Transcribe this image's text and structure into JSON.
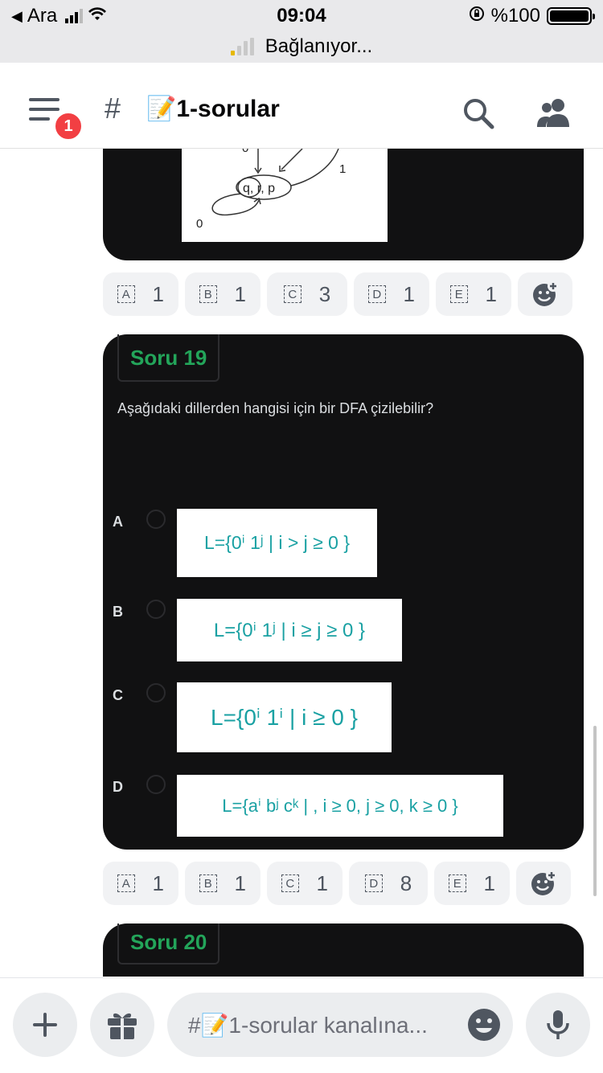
{
  "status_bar": {
    "back_label": "Ara",
    "time": "09:04",
    "battery_text": "%100",
    "connecting_text": "Bağlanıyor..."
  },
  "header": {
    "notification_count": "1",
    "channel_hash": "#",
    "channel_emoji": "📝",
    "channel_name": "1-sorular"
  },
  "previous_card": {
    "diagram_labels": {
      "top_label": "0",
      "node_label": "q, r, p",
      "right_label": "1",
      "bottom_label": "0"
    },
    "reactions": [
      {
        "key": "A",
        "count": "1"
      },
      {
        "key": "B",
        "count": "1"
      },
      {
        "key": "C",
        "count": "3"
      },
      {
        "key": "D",
        "count": "1"
      },
      {
        "key": "E",
        "count": "1"
      }
    ]
  },
  "question_19": {
    "tag": "Soru 19",
    "text": "Aşağıdaki dillerden hangisi için bir DFA çizilebilir?",
    "options": [
      {
        "letter": "A",
        "formula": "L={0ⁱ 1ʲ | i > j ≥ 0 }"
      },
      {
        "letter": "B",
        "formula": "L={0ⁱ 1ʲ | i ≥ j ≥ 0 }"
      },
      {
        "letter": "C",
        "formula": "L={0ⁱ 1ⁱ | i ≥ 0 }"
      },
      {
        "letter": "D",
        "formula": "L={aⁱ bʲ cᵏ | , i ≥ 0, j ≥ 0, k ≥ 0 }"
      }
    ],
    "reactions": [
      {
        "key": "A",
        "count": "1"
      },
      {
        "key": "B",
        "count": "1"
      },
      {
        "key": "C",
        "count": "1"
      },
      {
        "key": "D",
        "count": "8"
      },
      {
        "key": "E",
        "count": "1"
      }
    ]
  },
  "question_20": {
    "tag": "Soru 20"
  },
  "composer": {
    "placeholder": "#📝1-sorular kanalına..."
  },
  "colors": {
    "accent_green": "#23a55a",
    "formula_teal": "#1aa1a3",
    "badge_red": "#f23f43",
    "card_bg": "#111112"
  }
}
